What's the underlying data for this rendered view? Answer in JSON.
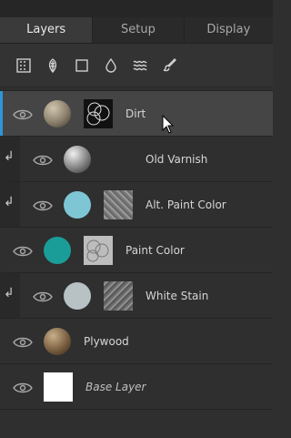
{
  "tabs": [
    {
      "label": "Layers",
      "active": true
    },
    {
      "label": "Setup",
      "active": false
    },
    {
      "label": "Display",
      "active": false
    }
  ],
  "toolbar": {
    "icons": [
      "grid-icon",
      "leaf-icon",
      "square-icon",
      "drop-icon",
      "waves-icon",
      "brush-icon"
    ]
  },
  "layers": [
    {
      "label": "Dirt",
      "selected": true,
      "child": false,
      "thumb": "dirt-sphere",
      "mask": true
    },
    {
      "label": "Old Varnish",
      "selected": false,
      "child": true,
      "thumb": "metal-sphere",
      "mask": false
    },
    {
      "label": "Alt. Paint Color",
      "selected": false,
      "child": true,
      "thumb": "cyan-sphere",
      "mask": true
    },
    {
      "label": "Paint Color",
      "selected": false,
      "child": false,
      "thumb": "teal-sphere",
      "mask": true
    },
    {
      "label": "White Stain",
      "selected": false,
      "child": true,
      "thumb": "light-sphere",
      "mask": true
    },
    {
      "label": "Plywood",
      "selected": false,
      "child": false,
      "thumb": "wood-sphere",
      "mask": false
    },
    {
      "label": "Base Layer",
      "selected": false,
      "child": false,
      "thumb": "white-square",
      "mask": false
    }
  ],
  "colors": {
    "accent": "#2f95d8",
    "cyan": "#7fc6d4",
    "teal": "#1a9d98",
    "light": "#b8c1c4"
  }
}
